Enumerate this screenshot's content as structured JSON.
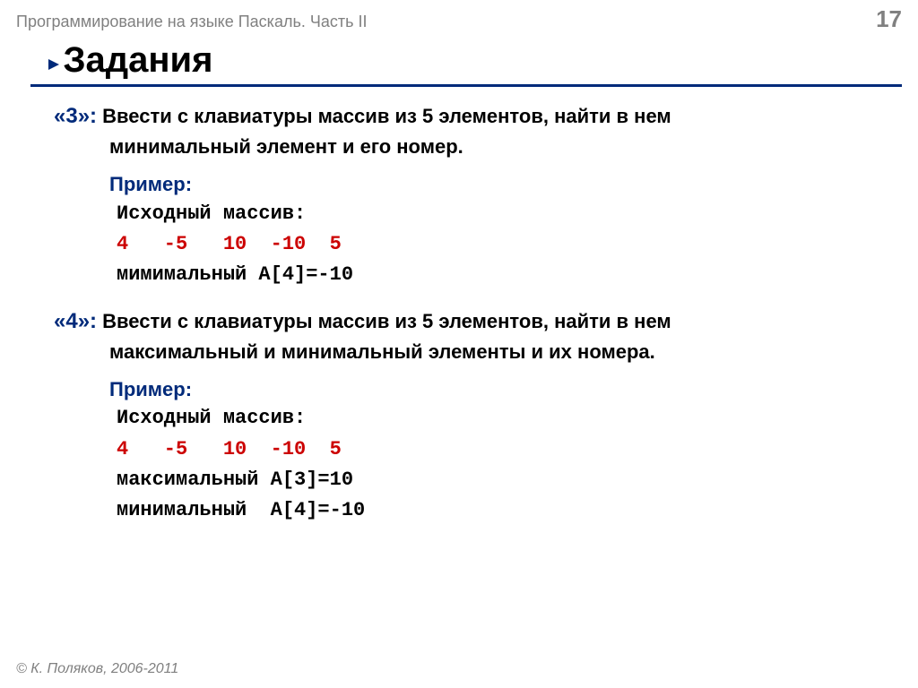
{
  "header": {
    "course": "Программирование на языке Паскаль. Часть II",
    "page": "17"
  },
  "title": "Задания",
  "task3": {
    "num": "«3»:",
    "line1": " Ввести с клавиатуры массив из 5 элементов, найти в нем",
    "line2": "минимальный элемент и его номер.",
    "example_label": "Пример:",
    "src_label": "Исходный массив:",
    "array": "4   -5   10  -10  5",
    "result": "мимимальный A[4]=-10"
  },
  "task4": {
    "num": "«4»:",
    "line1": " Ввести с клавиатуры массив из 5 элементов, найти в нем",
    "line2": "максимальный и минимальный элементы и их номера.",
    "example_label": "Пример:",
    "src_label": "Исходный массив:",
    "array": "4   -5   10  -10  5",
    "result_max": "максимальный A[3]=10",
    "result_min": "минимальный  A[4]=-10"
  },
  "footer": "© К. Поляков, 2006-2011"
}
